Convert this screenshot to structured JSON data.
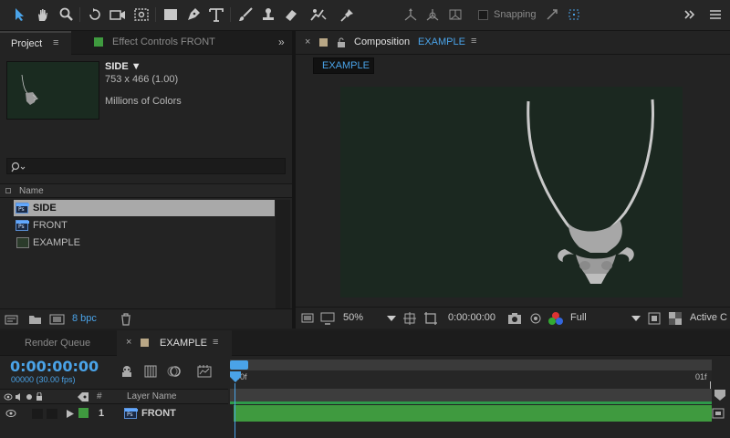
{
  "toolbar": {
    "snapping_label": "Snapping"
  },
  "project_panel": {
    "tab_label": "Project",
    "effect_controls_label": "Effect Controls FRONT",
    "selected_item": {
      "name": "SIDE ▼",
      "size": "753 x 466 (1.00)",
      "color_depth": "Millions of Colors"
    },
    "search_placeholder": "",
    "column_name": "Name",
    "items": [
      {
        "name": "SIDE",
        "type": "ps"
      },
      {
        "name": "FRONT",
        "type": "ps"
      },
      {
        "name": "EXAMPLE",
        "type": "comp"
      }
    ],
    "bpc_label": "8 bpc"
  },
  "composition_panel": {
    "tab_prefix": "Composition",
    "tab_name": "EXAMPLE",
    "sub_tab": "EXAMPLE",
    "zoom": "50%",
    "timecode": "0:00:00:00",
    "resolution": "Full",
    "active_camera": "Active C"
  },
  "timeline": {
    "render_queue_label": "Render Queue",
    "tab_label": "EXAMPLE",
    "timecode": "0:00:00:00",
    "frame_info": "00000 (30.00 fps)",
    "col_hash": "#",
    "col_layer_name": "Layer Name",
    "ruler_start": "00f",
    "ruler_end": "01f",
    "layers": [
      {
        "index": "1",
        "name": "FRONT",
        "color": "#3f9a3f"
      }
    ]
  },
  "colors": {
    "accent_blue": "#4aa3e8",
    "layer_green": "#3f9a3f",
    "comp_bg": "#1b2820"
  }
}
